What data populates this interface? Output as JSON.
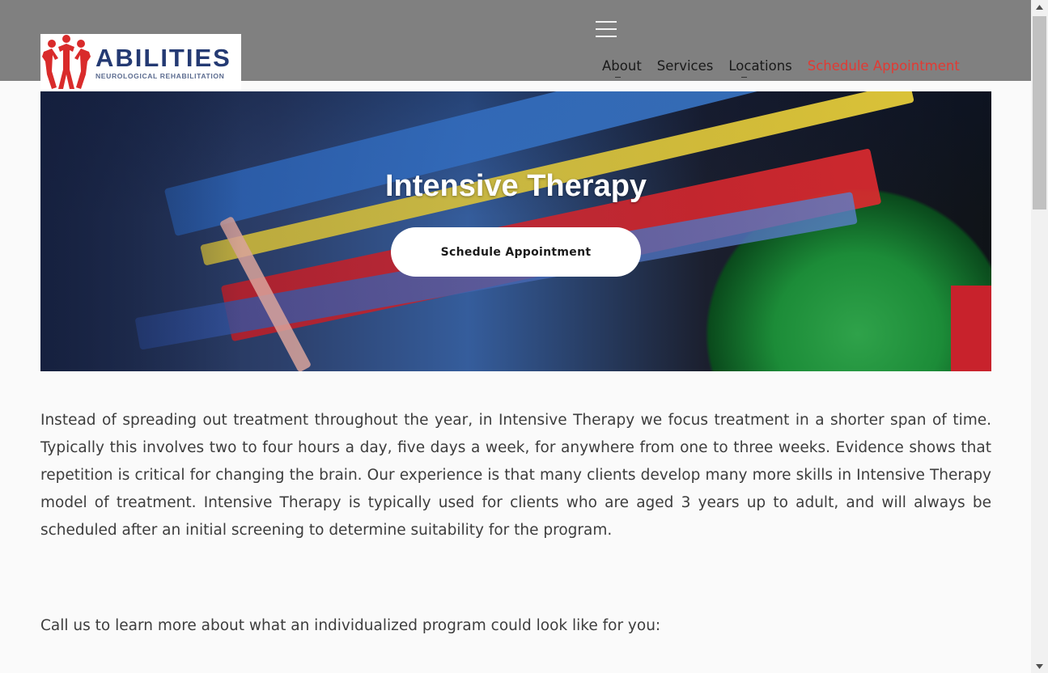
{
  "brand": {
    "name": "ABILITIES",
    "tagline": "NEUROLOGICAL REHABILITATION",
    "logo_icon": "figures-logo-icon",
    "colors": {
      "logo_red": "#d92b2b",
      "logo_navy": "#243a73"
    }
  },
  "nav": {
    "menu_icon": "hamburger-menu-icon",
    "items": [
      {
        "label": "About"
      },
      {
        "label": "Services"
      },
      {
        "label": "Locations"
      },
      {
        "label": "Schedule Appointment"
      }
    ],
    "accent_color": "#e23a33"
  },
  "hero": {
    "title": "Intensive Therapy",
    "button_label": "Schedule Appointment"
  },
  "content": {
    "paragraph": "Instead of spreading out treatment throughout the year, in Intensive Therapy we focus treatment in a shorter span of time. Typically this involves two to four hours a day, five days a week, for anywhere from one to three weeks. Evidence shows that repetition is critical for changing the brain. Our experience is that many clients develop many more skills in Intensive Therapy model of treatment. Intensive Therapy is typically used for clients who are aged 3 years up to adult, and will always be scheduled after an initial screening to determine suitability for the program.",
    "call_text": "Call us to learn more about what an individualized program could look like for you:"
  }
}
